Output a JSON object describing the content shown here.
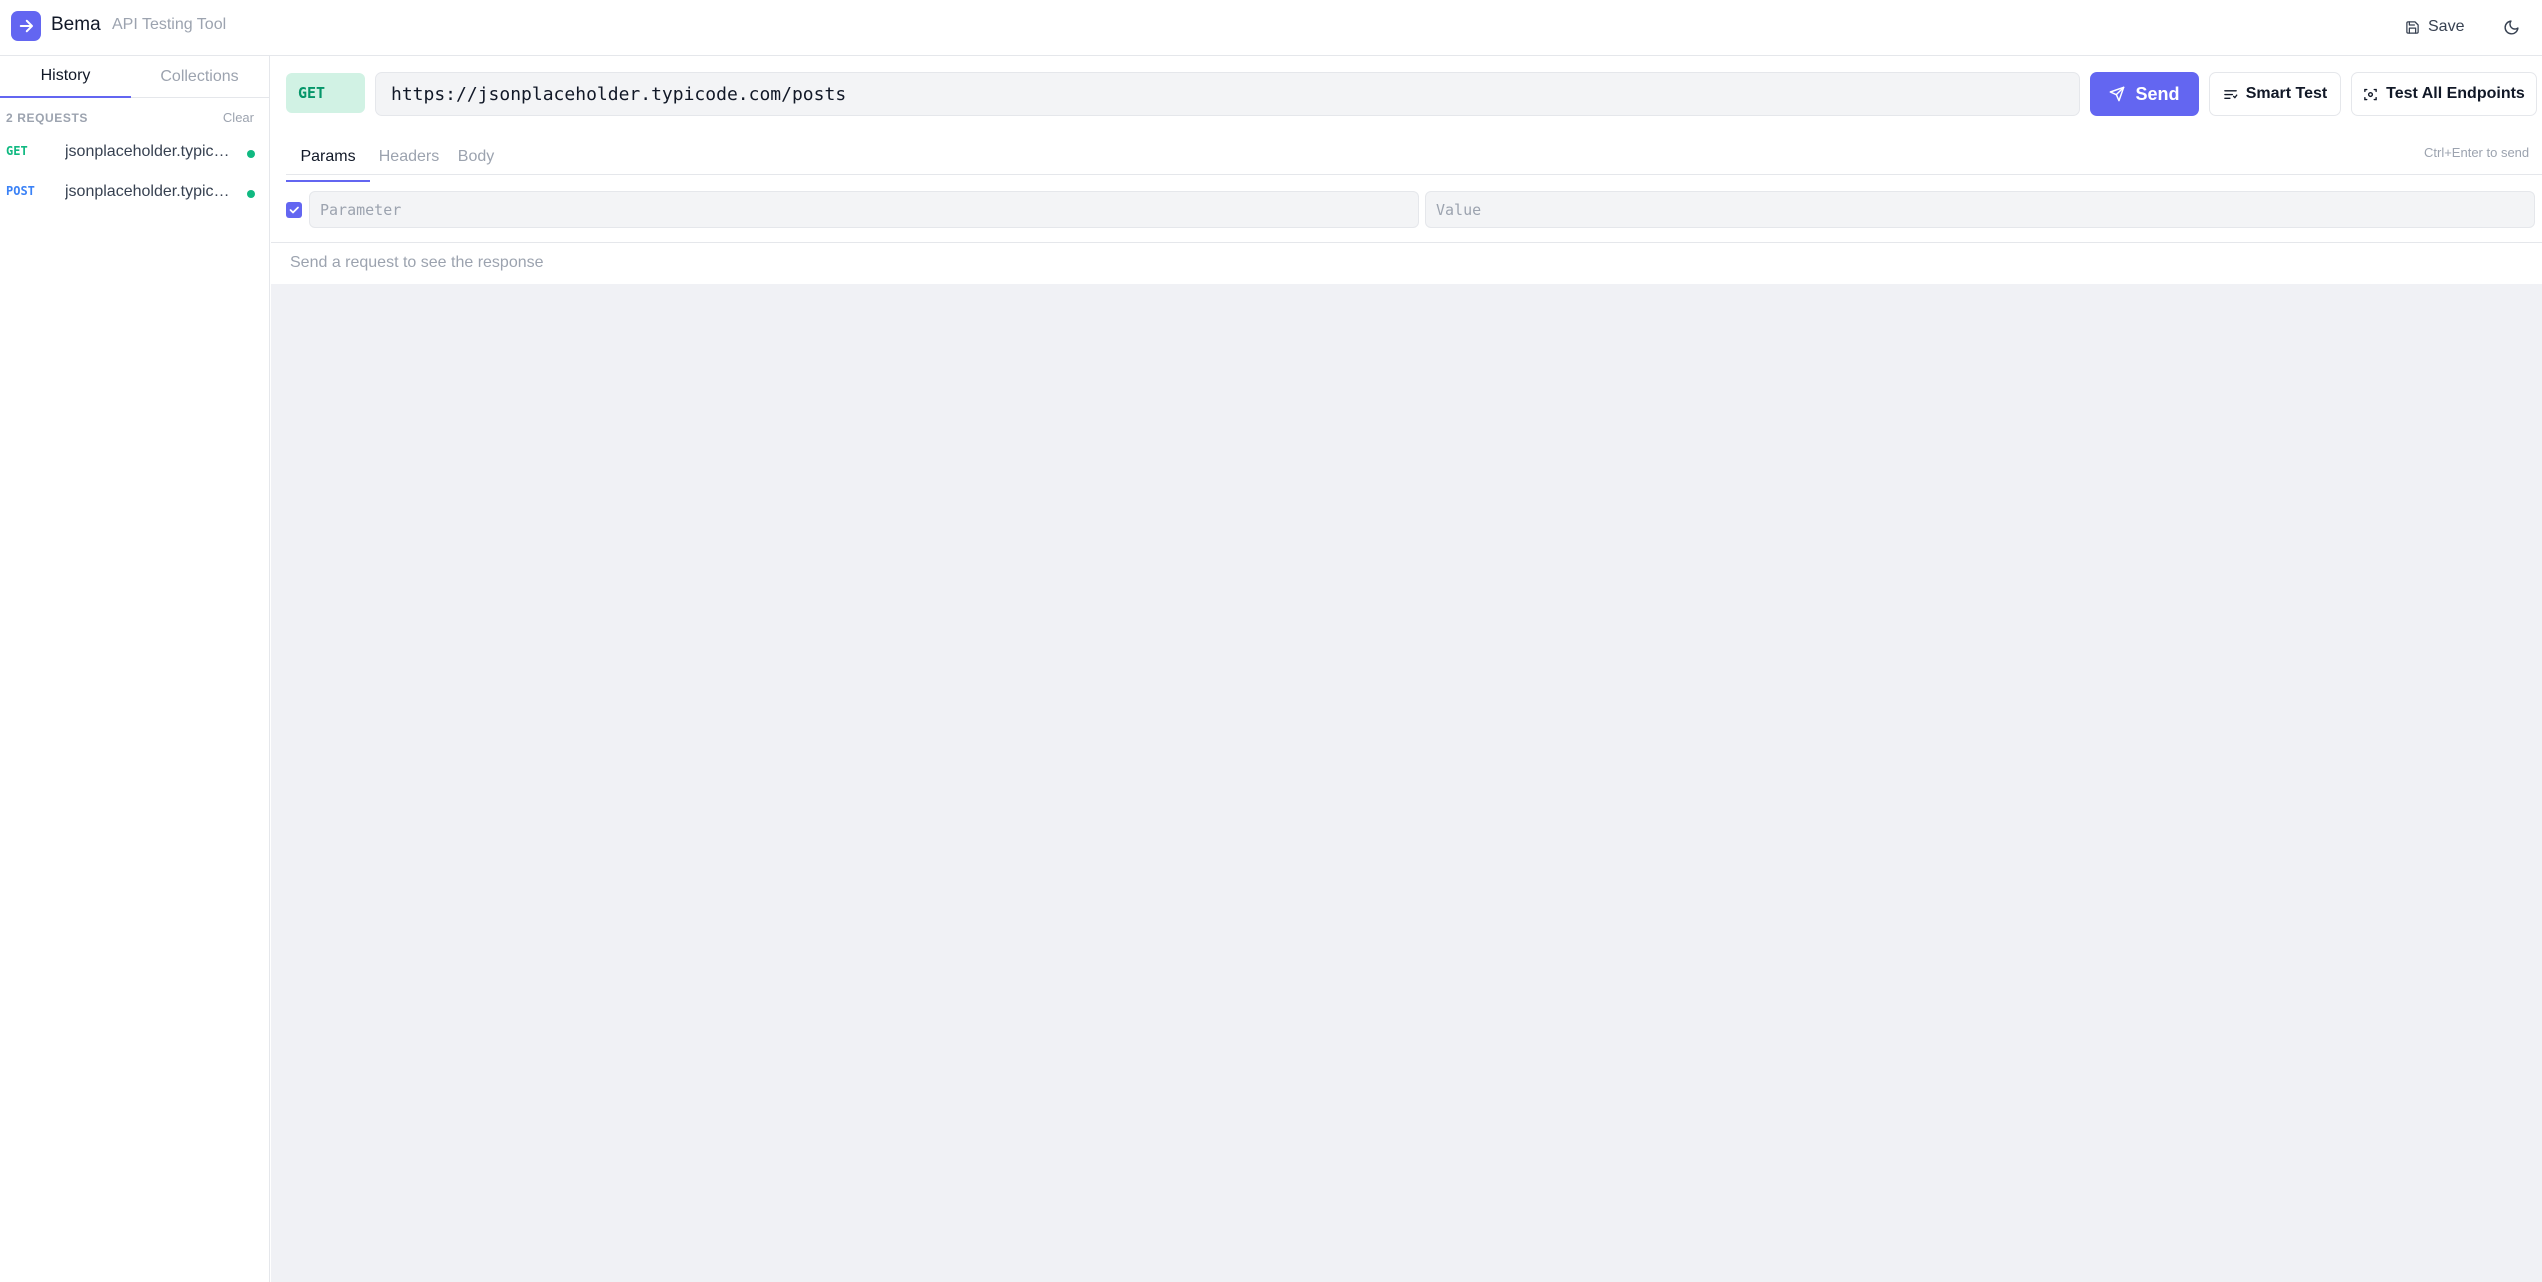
{
  "header": {
    "app_name": "Bema",
    "app_subtitle": "API Testing Tool",
    "save_label": "Save",
    "logo_icon": "arrow-right-icon",
    "theme_icon": "moon-icon"
  },
  "sidebar": {
    "tabs": [
      {
        "label": "History",
        "active": true
      },
      {
        "label": "Collections",
        "active": false
      }
    ],
    "request_count_label": "2 REQUESTS",
    "clear_label": "Clear",
    "history": [
      {
        "method": "GET",
        "method_color": "#10b981",
        "url": "jsonplaceholder.typicode.com/posts",
        "status_color": "#10b981"
      },
      {
        "method": "POST",
        "method_color": "#3b82f6",
        "url": "jsonplaceholder.typicode.com/posts",
        "status_color": "#10b981"
      }
    ]
  },
  "request": {
    "method": "GET",
    "url": "https://jsonplaceholder.typicode.com/posts",
    "send_label": "Send",
    "smart_test_label": "Smart Test",
    "test_all_label": "Test All Endpoints",
    "tabs": [
      {
        "label": "Params",
        "active": true
      },
      {
        "label": "Headers",
        "active": false
      },
      {
        "label": "Body",
        "active": false
      }
    ],
    "shortcut_hint": "Ctrl+Enter to send",
    "params": [
      {
        "enabled": true,
        "key_placeholder": "Parameter",
        "value_placeholder": "Value"
      }
    ]
  },
  "response": {
    "empty_text": "Send a request to see the response"
  },
  "colors": {
    "accent": "#6366f1",
    "get_badge_bg": "#d1f2e4",
    "get_badge_text": "#059669",
    "success": "#10b981"
  }
}
